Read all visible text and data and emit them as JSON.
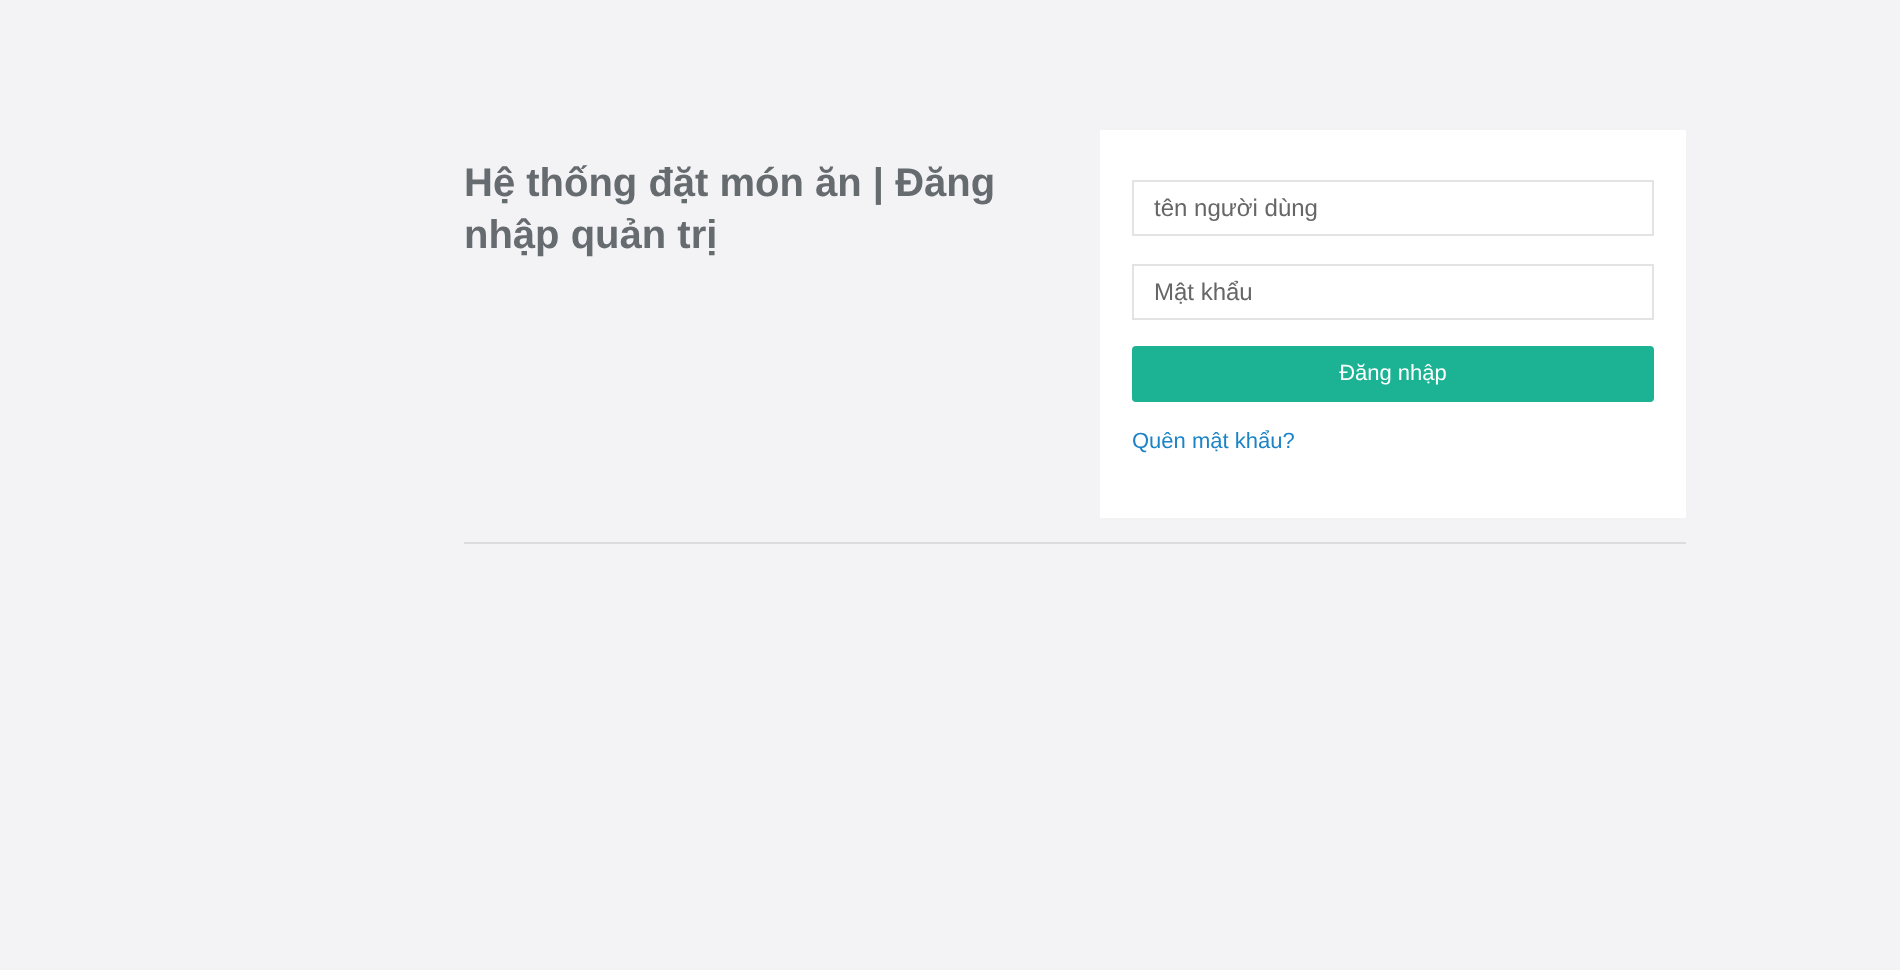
{
  "heading": "Hệ thống đặt món ăn | Đăng nhập quản trị",
  "login_form": {
    "username": {
      "placeholder": "tên người dùng"
    },
    "password": {
      "placeholder": "Mật khẩu"
    },
    "submit_button": "Đăng nhập",
    "forgot_link": "Quên mật khẩu?"
  }
}
